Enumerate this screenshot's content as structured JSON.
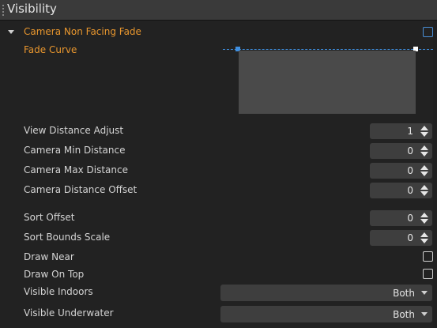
{
  "header": {
    "title": "Visibility"
  },
  "camera_fade": {
    "label": "Camera Non Facing Fade",
    "enabled": false,
    "fade_curve_label": "Fade Curve"
  },
  "fields": {
    "view_distance_adjust": {
      "label": "View Distance Adjust",
      "value": "1"
    },
    "camera_min_distance": {
      "label": "Camera Min Distance",
      "value": "0"
    },
    "camera_max_distance": {
      "label": "Camera Max Distance",
      "value": "0"
    },
    "camera_distance_offset": {
      "label": "Camera Distance Offset",
      "value": "0"
    },
    "sort_offset": {
      "label": "Sort Offset",
      "value": "0"
    },
    "sort_bounds_scale": {
      "label": "Sort Bounds Scale",
      "value": "0"
    }
  },
  "checks": {
    "draw_near": {
      "label": "Draw Near",
      "checked": false
    },
    "draw_on_top": {
      "label": "Draw On Top",
      "checked": false
    }
  },
  "dropdowns": {
    "visible_indoors": {
      "label": "Visible Indoors",
      "value": "Both"
    },
    "visible_underwater": {
      "label": "Visible Underwater",
      "value": "Both"
    }
  },
  "colors": {
    "accent_orange": "#e8962e",
    "accent_blue": "#3f8fe0"
  }
}
